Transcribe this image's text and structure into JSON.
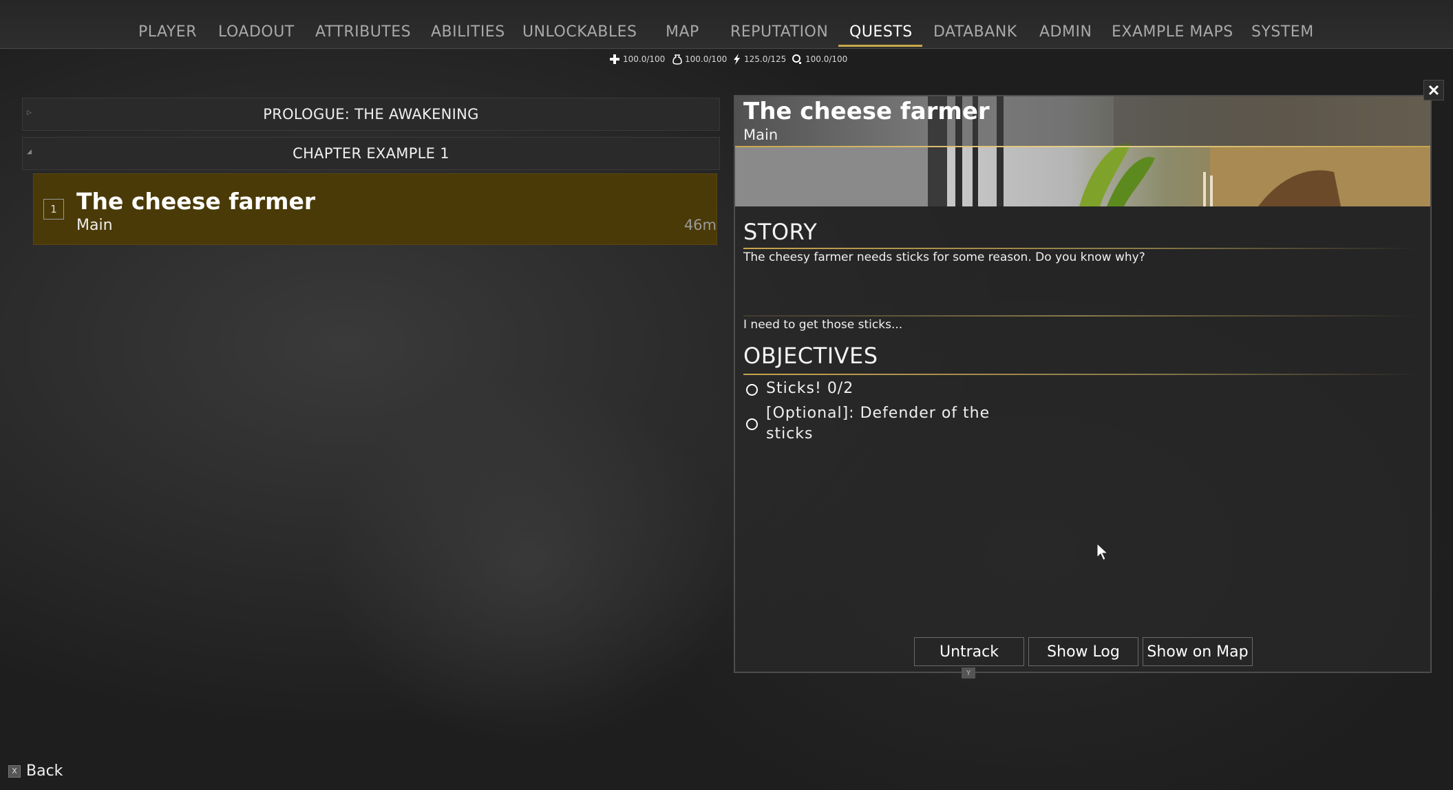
{
  "nav": {
    "tabs": [
      {
        "label": "PLAYER"
      },
      {
        "label": "LOADOUT"
      },
      {
        "label": "ATTRIBUTES"
      },
      {
        "label": "ABILITIES"
      },
      {
        "label": "UNLOCKABLES"
      },
      {
        "label": "MAP"
      },
      {
        "label": "REPUTATION"
      },
      {
        "label": "QUESTS"
      },
      {
        "label": "DATABANK"
      },
      {
        "label": "ADMIN"
      },
      {
        "label": "EXAMPLE MAPS"
      },
      {
        "label": "SYSTEM"
      }
    ],
    "active_tab": "QUESTS",
    "accent_color": "#c8a84a"
  },
  "stats": [
    {
      "icon": "health-cross-icon",
      "value": "100.0/100"
    },
    {
      "icon": "hunger-bag-icon",
      "value": "100.0/100"
    },
    {
      "icon": "energy-bolt-icon",
      "value": "125.0/125"
    },
    {
      "icon": "oxygen-icon",
      "value": "100.0/100"
    }
  ],
  "quest_list": {
    "chapters": [
      {
        "label": "PROLOGUE: THE AWAKENING",
        "expanded": false
      },
      {
        "label": "CHAPTER EXAMPLE 1",
        "expanded": true
      }
    ],
    "selected_quest": {
      "number": "1",
      "title": "The cheese farmer",
      "type": "Main",
      "distance": "46m",
      "highlight_color": "#4a3a07"
    }
  },
  "detail": {
    "title": "The cheese farmer",
    "type": "Main",
    "story_heading": "STORY",
    "story_text": "The cheesy farmer needs sticks for some reason. Do you know why?",
    "log_text": "I need to get those sticks...",
    "objectives_heading": "OBJECTIVES",
    "objectives": [
      {
        "text": "Sticks! 0/2",
        "completed": false
      },
      {
        "text": "[Optional]: Defender of the sticks",
        "completed": false
      }
    ],
    "buttons": {
      "untrack": "Untrack",
      "show_log": "Show Log",
      "show_on_map": "Show on Map",
      "untrack_hint_key": "Y"
    }
  },
  "footer": {
    "back_key": "X",
    "back_label": "Back"
  }
}
